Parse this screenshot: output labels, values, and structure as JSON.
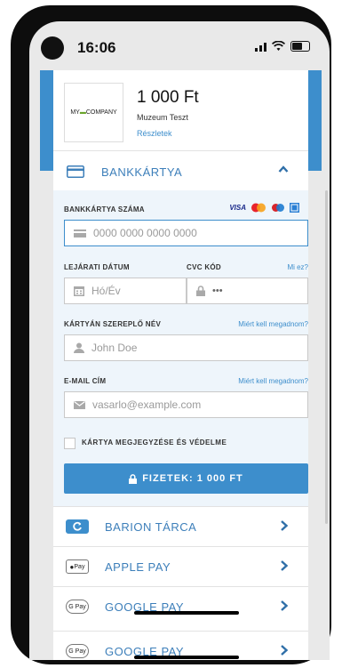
{
  "status": {
    "time": "16:06"
  },
  "merchant": {
    "logo_text_left": "MY",
    "logo_text_right": "COMPANY",
    "amount": "1 000 Ft",
    "shop_name": "Muzeum Teszt",
    "details_link": "Részletek"
  },
  "bankcard": {
    "title": "BANKKÁRTYA",
    "card_number_label": "BANKKÁRTYA SZÁMA",
    "card_number_placeholder": "0000 0000 0000 0000",
    "brands": [
      "VISA"
    ],
    "expiry_label": "LEJÁRATI DÁTUM",
    "expiry_placeholder": "Hó/Év",
    "cvc_label": "CVC KÓD",
    "cvc_help": "Mi ez?",
    "cvc_placeholder": "•••",
    "name_label": "KÁRTYÁN SZEREPLŐ NÉV",
    "name_help": "Miért kell megadnom?",
    "name_placeholder": "John Doe",
    "email_label": "E-MAIL CÍM",
    "email_help": "Miért kell megadnom?",
    "email_placeholder": "vasarlo@example.com",
    "remember_label": "KÁRTYA MEGJEGYZÉSE ÉS VÉDELME",
    "pay_button": "FIZETEK: 1 000 FT"
  },
  "options": [
    {
      "label": "BARION TÁRCA",
      "badge": ""
    },
    {
      "label": "APPLE PAY",
      "badge": "Pay"
    },
    {
      "label": "GOOGLE PAY",
      "badge": "G Pay"
    },
    {
      "label": "GOOGLE PAY",
      "badge": "G Pay"
    }
  ],
  "colors": {
    "accent": "#3d8ecc",
    "frame": "#0d0d0d"
  }
}
